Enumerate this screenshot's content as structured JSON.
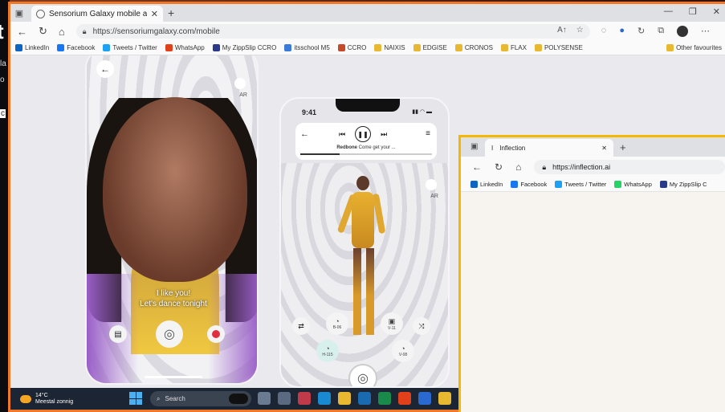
{
  "main_browser": {
    "tab_title": "Sensorium Galaxy mobile avatar",
    "url": "https://sensoriumgalaxy.com/mobile",
    "bookmarks": [
      {
        "label": "LinkedIn",
        "color": "#0a66c2"
      },
      {
        "label": "Facebook",
        "color": "#1877f2"
      },
      {
        "label": "Tweets / Twitter",
        "color": "#1da1f2"
      },
      {
        "label": "WhatsApp",
        "color": "#e0401a"
      },
      {
        "label": "My ZippSlip CCRO",
        "color": "#2a3a8a"
      },
      {
        "label": "itsschool M5",
        "color": "#3a7ad8"
      },
      {
        "label": "CCRO",
        "color": "#c44a2a"
      },
      {
        "label": "NAIXIS",
        "color": "#e8b830"
      },
      {
        "label": "EDGISE",
        "color": "#e8b830"
      },
      {
        "label": "CRONOS",
        "color": "#e8b830"
      },
      {
        "label": "FLAX",
        "color": "#e8b830"
      },
      {
        "label": "POLYSENSE",
        "color": "#e8b830"
      }
    ],
    "other_favourites": "Other favourites",
    "read_aloud_icon": "A↑"
  },
  "phone1": {
    "ar_label": "AR",
    "chat_line1": "I like you!",
    "chat_line2": "Let's dance tonight"
  },
  "phone2": {
    "time": "9:41",
    "song_artist": "Redbone",
    "song_title": "Come get your ...",
    "progress": 0.3,
    "ar_label": "AR",
    "avatars": [
      {
        "code": "B-06"
      },
      {
        "code": "V-11"
      },
      {
        "code": "H-115"
      },
      {
        "code": "V-08"
      }
    ]
  },
  "taskbar": {
    "temp": "14°C",
    "weather": "Meestal zonnig",
    "search": "Search",
    "app_colors": [
      "#6a7a90",
      "#5a6a80",
      "#c03a4a",
      "#1a8ad0",
      "#e8b830",
      "#1a6ab0",
      "#1a8a4a",
      "#e0401a",
      "#2a6ad0",
      "#e8b830",
      "#d03a2a"
    ]
  },
  "inflection": {
    "tab_title": "Inflection",
    "url": "https://inflection.ai",
    "bookmarks": [
      {
        "label": "LinkedIn",
        "color": "#0a66c2"
      },
      {
        "label": "Facebook",
        "color": "#1877f2"
      },
      {
        "label": "Tweets / Twitter",
        "color": "#1da1f2"
      },
      {
        "label": "WhatsApp",
        "color": "#25d366"
      },
      {
        "label": "My ZippSlip C",
        "color": "#2a3a8a"
      }
    ]
  },
  "desktop_left": {
    "big_letter": "t",
    "snippet1": "la",
    "snippet2": "o",
    "snippet3": "c"
  }
}
